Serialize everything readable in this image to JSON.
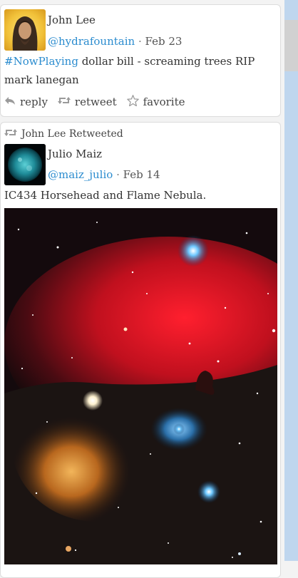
{
  "tweets": [
    {
      "name": "John Lee",
      "handle": "@hydrafountain",
      "date": "Feb 23",
      "hashtag": "#NowPlaying",
      "text_rest": " dollar bill - screaming trees RIP mark lanegan",
      "actions": {
        "reply": "reply",
        "retweet": "retweet",
        "favorite": "favorite"
      }
    },
    {
      "retweeted_by": "John Lee Retweeted",
      "name": "Julio Maiz",
      "handle": "@maiz_julio",
      "date": "Feb 14",
      "text": "IC434 Horsehead and Flame Nebula."
    }
  ],
  "separator": "·",
  "colors": {
    "link": "#2b8ccf",
    "scrollbar_track": "#bfd6ee"
  },
  "icons": [
    "reply-icon",
    "retweet-icon",
    "star-icon"
  ]
}
